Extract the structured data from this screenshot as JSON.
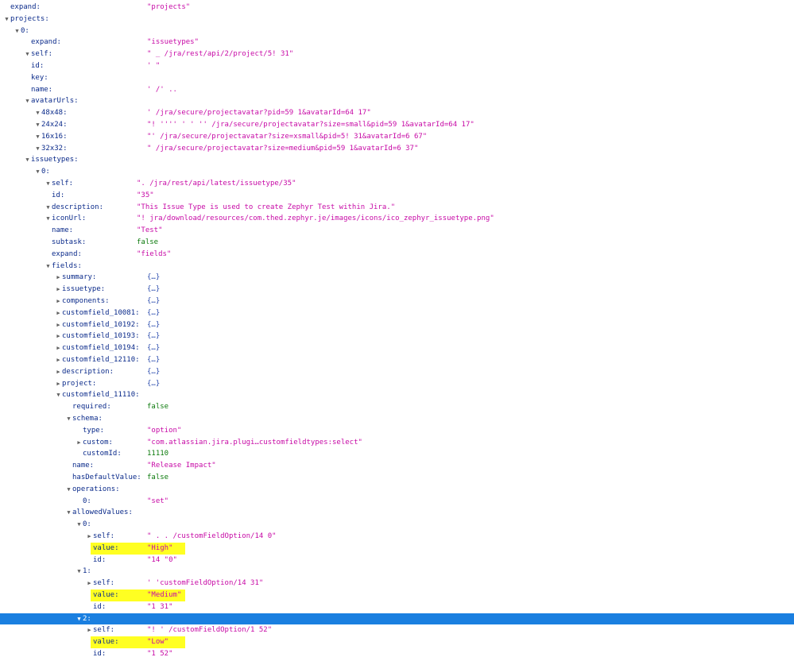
{
  "theme": {
    "string": "#c70aa6",
    "literal": "#0c7a0c",
    "key": "#0a2a8a",
    "highlight": "#ffff22",
    "selection": "#1a7fe0"
  },
  "rows": [
    {
      "key": "expand:",
      "value": "\"projects\"",
      "type": "str",
      "toggle": "",
      "indent": 0
    },
    {
      "key": "projects:",
      "value": "",
      "type": "",
      "toggle": "open",
      "indent": 0
    },
    {
      "key": "0:",
      "value": "",
      "type": "",
      "toggle": "open",
      "indent": 1
    },
    {
      "key": "expand:",
      "value": "\"issuetypes\"",
      "type": "str",
      "toggle": "",
      "indent": 2
    },
    {
      "key": "self:",
      "value": "\"          _                /jra/rest/api/2/project/5!  31\"",
      "type": "str",
      "toggle": "open",
      "indent": 2
    },
    {
      "key": "id:",
      "value": "'     \"",
      "type": "str",
      "toggle": "",
      "indent": 2
    },
    {
      "key": "key:",
      "value": "",
      "type": "",
      "toggle": "",
      "indent": 2
    },
    {
      "key": "name:",
      "value": "             ' /'                            ..",
      "type": "str",
      "toggle": "",
      "indent": 2
    },
    {
      "key": "avatarUrls:",
      "value": "",
      "type": "",
      "toggle": "open",
      "indent": 2
    },
    {
      "key": "48x48:",
      "value": "'                         /jra/secure/projectavatar?pid=59  1&avatarId=64  17\"",
      "type": "str",
      "toggle": "open",
      "indent": 3
    },
    {
      "key": "24x24:",
      "value": "\"!     ''''   ' ' ''     /jra/secure/projectavatar?size=small&pid=59  1&avatarId=64  17\"",
      "type": "str",
      "toggle": "open",
      "indent": 3
    },
    {
      "key": "16x16:",
      "value": "\"'                       /jra/secure/projectavatar?size=xsmall&pid=5!  31&avatarId=6   67\"",
      "type": "str",
      "toggle": "open",
      "indent": 3
    },
    {
      "key": "32x32:",
      "value": "\"                        /jra/secure/projectavatar?size=medium&pid=59  1&avatarId=6   37\"",
      "type": "str",
      "toggle": "open",
      "indent": 3
    },
    {
      "key": "issuetypes:",
      "value": "",
      "type": "",
      "toggle": "open",
      "indent": 2
    },
    {
      "key": "0:",
      "value": "",
      "type": "",
      "toggle": "open",
      "indent": 3
    },
    {
      "key": "self:",
      "value": "\".                        /jra/rest/api/latest/issuetype/35\"",
      "type": "str",
      "toggle": "open",
      "indent": 4
    },
    {
      "key": "id:",
      "value": "\"35\"",
      "type": "str",
      "toggle": "",
      "indent": 4
    },
    {
      "key": "description:",
      "value": "\"This Issue Type is used to create Zephyr Test within Jira.\"",
      "type": "str",
      "toggle": "open",
      "indent": 4
    },
    {
      "key": "iconUrl:",
      "value": "\"!                          jra/download/resources/com.thed.zephyr.je/images/icons/ico_zephyr_issuetype.png\"",
      "type": "str",
      "toggle": "open",
      "indent": 4
    },
    {
      "key": "name:",
      "value": "\"Test\"",
      "type": "str",
      "toggle": "",
      "indent": 4
    },
    {
      "key": "subtask:",
      "value": "false",
      "type": "bool",
      "toggle": "",
      "indent": 4
    },
    {
      "key": "expand:",
      "value": "\"fields\"",
      "type": "str",
      "toggle": "",
      "indent": 4
    },
    {
      "key": "fields:",
      "value": "",
      "type": "",
      "toggle": "open",
      "indent": 4
    },
    {
      "key": "summary:",
      "value": "{…}",
      "type": "obj",
      "toggle": "closed",
      "indent": 5
    },
    {
      "key": "issuetype:",
      "value": "{…}",
      "type": "obj",
      "toggle": "closed",
      "indent": 5
    },
    {
      "key": "components:",
      "value": "{…}",
      "type": "obj",
      "toggle": "closed",
      "indent": 5
    },
    {
      "key": "customfield_10081:",
      "value": "{…}",
      "type": "obj",
      "toggle": "closed",
      "indent": 5
    },
    {
      "key": "customfield_10192:",
      "value": "{…}",
      "type": "obj",
      "toggle": "closed",
      "indent": 5
    },
    {
      "key": "customfield_10193:",
      "value": "{…}",
      "type": "obj",
      "toggle": "closed",
      "indent": 5
    },
    {
      "key": "customfield_10194:",
      "value": "{…}",
      "type": "obj",
      "toggle": "closed",
      "indent": 5
    },
    {
      "key": "customfield_12110:",
      "value": "{…}",
      "type": "obj",
      "toggle": "closed",
      "indent": 5
    },
    {
      "key": "description:",
      "value": "{…}",
      "type": "obj",
      "toggle": "closed",
      "indent": 5
    },
    {
      "key": "project:",
      "value": "{…}",
      "type": "obj",
      "toggle": "closed",
      "indent": 5
    },
    {
      "key": "customfield_11110:",
      "value": "",
      "type": "",
      "toggle": "open",
      "indent": 5
    },
    {
      "key": "required:",
      "value": "false",
      "type": "bool",
      "toggle": "",
      "indent": 6
    },
    {
      "key": "schema:",
      "value": "",
      "type": "",
      "toggle": "open",
      "indent": 6
    },
    {
      "key": "type:",
      "value": "\"option\"",
      "type": "str",
      "toggle": "",
      "indent": 7
    },
    {
      "key": "custom:",
      "value": "\"com.atlassian.jira.plugi…customfieldtypes:select\"",
      "type": "str",
      "toggle": "closed",
      "indent": 7
    },
    {
      "key": "customId:",
      "value": "11110",
      "type": "num",
      "toggle": "",
      "indent": 7
    },
    {
      "key": "name:",
      "value": "\"Release Impact\"",
      "type": "str",
      "toggle": "",
      "indent": 6
    },
    {
      "key": "hasDefaultValue:",
      "value": "false",
      "type": "bool",
      "toggle": "",
      "indent": 6
    },
    {
      "key": "operations:",
      "value": "",
      "type": "",
      "toggle": "open",
      "indent": 6
    },
    {
      "key": "0:",
      "value": "\"set\"",
      "type": "str",
      "toggle": "",
      "indent": 7
    },
    {
      "key": "allowedValues:",
      "value": "",
      "type": "",
      "toggle": "open",
      "indent": 6
    },
    {
      "key": "0:",
      "value": "",
      "type": "",
      "toggle": "open",
      "indent": 7
    },
    {
      "key": "self:",
      "value": "\" .         .             /customFieldOption/14  0\"",
      "type": "str",
      "toggle": "closed",
      "indent": 8
    },
    {
      "key": "value:",
      "value": "\"High\"",
      "type": "str",
      "toggle": "",
      "indent": 8,
      "highlight": true
    },
    {
      "key": "id:",
      "value": "\"14 \"0\"",
      "type": "str",
      "toggle": "",
      "indent": 8
    },
    {
      "key": "1:",
      "value": "",
      "type": "",
      "toggle": "open",
      "indent": 7
    },
    {
      "key": "self:",
      "value": "'                          'customFieldOption/14  31\"",
      "type": "str",
      "toggle": "closed",
      "indent": 8
    },
    {
      "key": "value:",
      "value": "\"Medium\"",
      "type": "str",
      "toggle": "",
      "indent": 8,
      "highlight": true
    },
    {
      "key": "id:",
      "value": "\"1  31\"",
      "type": "str",
      "toggle": "",
      "indent": 8
    },
    {
      "key": "2:",
      "value": "",
      "type": "",
      "toggle": "open",
      "indent": 7,
      "selected": true
    },
    {
      "key": "self:",
      "value": "\"!               '        /customFieldOption/1   52\"",
      "type": "str",
      "toggle": "closed",
      "indent": 8
    },
    {
      "key": "value:",
      "value": "\"Low\"",
      "type": "str",
      "toggle": "",
      "indent": 8,
      "highlight": true
    },
    {
      "key": "id:",
      "value": "\"1  52\"",
      "type": "str",
      "toggle": "",
      "indent": 8
    }
  ]
}
